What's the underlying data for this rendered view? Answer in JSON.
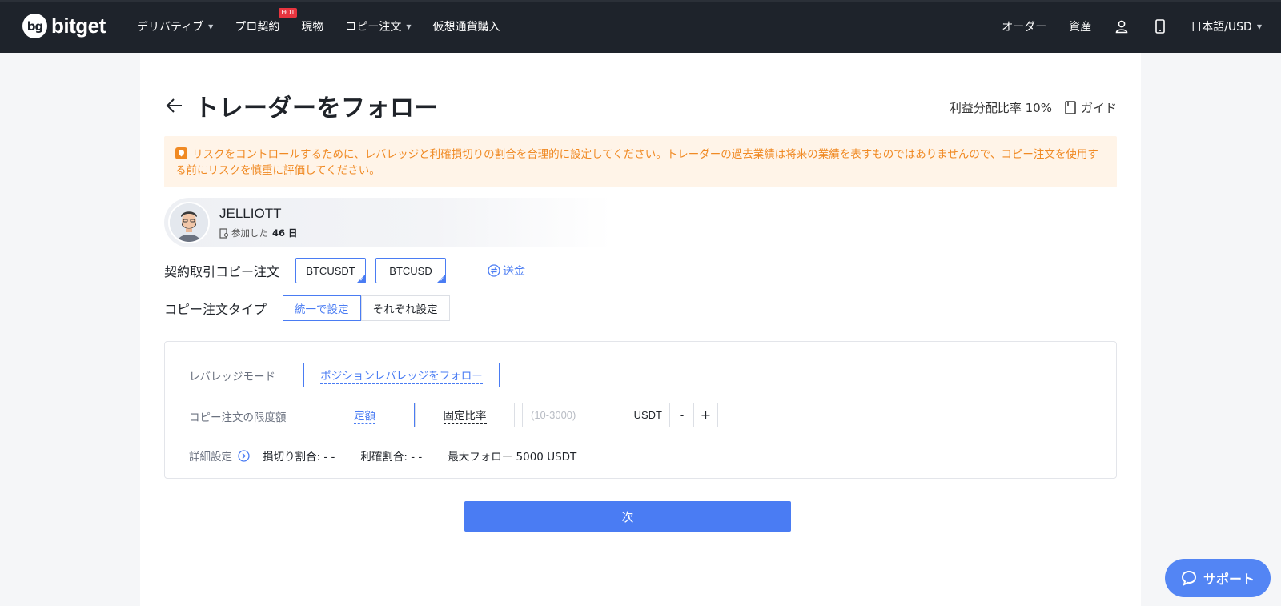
{
  "brand": {
    "name": "bitget",
    "mark": "bg"
  },
  "nav": {
    "items": [
      {
        "label": "デリバティブ",
        "has_caret": true
      },
      {
        "label": "プロ契約",
        "badge": "HOT"
      },
      {
        "label": "現物"
      },
      {
        "label": "コピー注文",
        "has_caret": true
      },
      {
        "label": "仮想通貨購入"
      }
    ],
    "orders": "オーダー",
    "assets": "資産",
    "language": "日本語/USD"
  },
  "page": {
    "title": "トレーダーをフォロー",
    "profit_share": "利益分配比率 10%",
    "guide": "ガイド"
  },
  "warning": {
    "text": "リスクをコントロールするために、レバレッジと利確損切りの割合を合理的に設定してください。トレーダーの過去業績は将来の業績を表すものではありませんので、コピー注文を使用する前にリスクを慎重に評価してください。"
  },
  "trader": {
    "name": "JELLIOTT",
    "joined_prefix": "参加した",
    "joined_days": "46 日"
  },
  "contract": {
    "label": "契約取引コピー注文",
    "pairs": [
      "BTCUSDT",
      "BTCUSD"
    ],
    "transfer": "送金"
  },
  "copy_type": {
    "label": "コピー注文タイプ",
    "options": [
      "統一で設定",
      "それぞれ設定"
    ],
    "selected": "統一で設定"
  },
  "settings": {
    "leverage_label": "レバレッジモード",
    "leverage_value": "ポジションレバレッジをフォロー",
    "limit_label": "コピー注文の限度額",
    "limit_options": [
      "定額",
      "固定比率"
    ],
    "limit_selected": "定額",
    "amount_placeholder": "(10-3000)",
    "amount_value": "",
    "unit": "USDT",
    "minus": "-",
    "plus": "+",
    "detail_label": "詳細設定",
    "stop_loss": "損切り割合: - -",
    "take_profit": "利確割合: - -",
    "max_follow": "最大フォロー 5000 USDT"
  },
  "next_button": "次",
  "support": "サポート",
  "colors": {
    "accent": "#4a7cf3",
    "nav_bg": "#1e232b",
    "warning_text": "#f08a24",
    "warning_bg": "#fff4e8",
    "hot_badge": "#e8353f"
  }
}
